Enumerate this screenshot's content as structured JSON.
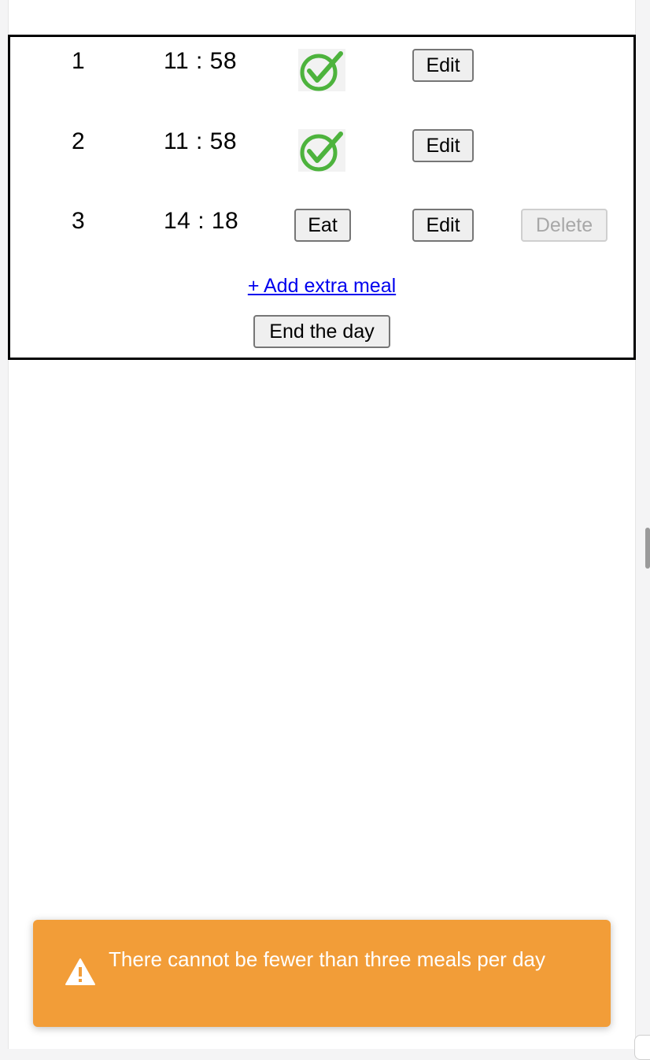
{
  "meals": [
    {
      "number": "1",
      "time": "11 : 58",
      "status": "eaten",
      "edit_label": "Edit"
    },
    {
      "number": "2",
      "time": "11 : 58",
      "status": "eaten",
      "edit_label": "Edit"
    },
    {
      "number": "3",
      "time": "14 : 18",
      "status": "pending",
      "eat_label": "Eat",
      "edit_label": "Edit",
      "delete_label": "Delete"
    }
  ],
  "add_meal_link": "+ Add extra meal",
  "end_day_label": "End the day",
  "toast": {
    "icon": "warning-icon",
    "message": "There cannot be fewer than three meals per day",
    "color": "#f29d38"
  },
  "colors": {
    "check_green": "#4db33d",
    "link_blue": "#0000ee"
  }
}
